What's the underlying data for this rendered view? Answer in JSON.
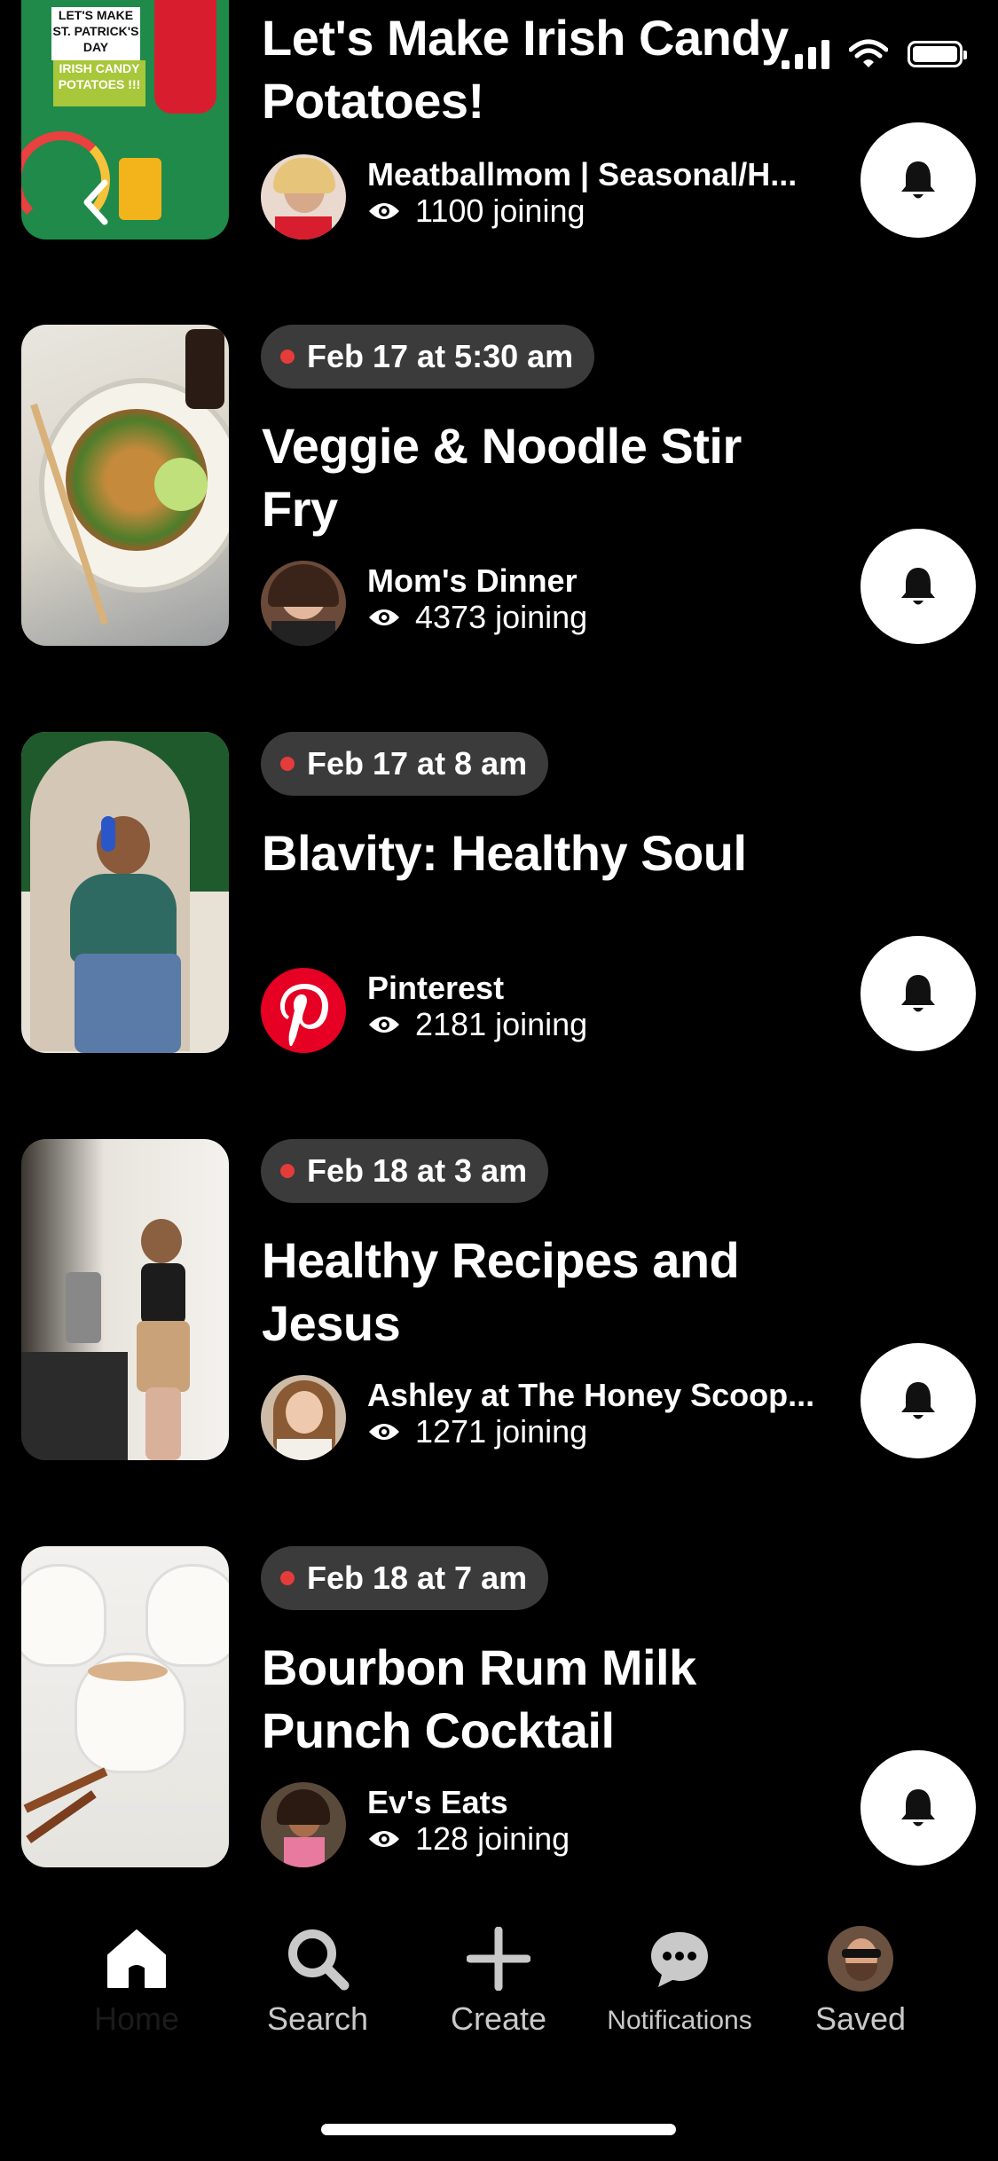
{
  "status_bar": {
    "signal_icon": "cellular-signal-icon",
    "wifi_icon": "wifi-icon",
    "battery_icon": "battery-icon"
  },
  "events": [
    {
      "date": "",
      "title": "Let's Make Irish Candy Potatoes!",
      "creator": "Meatballmom |  Seasonal/H...",
      "joining": "1100 joining",
      "thumbnail_text": "LET'S MAKE ST. PATRICK'S DAY IRISH CANDY POTATOES !!!",
      "bell_icon": "bell-icon"
    },
    {
      "date": "Feb 17 at 5:30 am",
      "title": "Veggie & Noodle Stir Fry",
      "creator": "Mom's Dinner",
      "joining": "4373 joining",
      "bell_icon": "bell-icon"
    },
    {
      "date": "Feb 17 at 8 am",
      "title": "Blavity: Healthy Soul",
      "creator": "Pinterest",
      "joining": "2181 joining",
      "bell_icon": "bell-icon"
    },
    {
      "date": "Feb 18 at 3 am",
      "title": "Healthy Recipes and Jesus",
      "creator": "Ashley at The Honey Scoop...",
      "joining": "1271 joining",
      "bell_icon": "bell-icon"
    },
    {
      "date": "Feb 18 at 7 am",
      "title": "Bourbon Rum Milk Punch Cocktail",
      "creator": "Ev's Eats",
      "joining": "128 joining",
      "bell_icon": "bell-icon"
    }
  ],
  "tabbar": {
    "home": "Home",
    "search": "Search",
    "create": "Create",
    "notifications": "Notifications",
    "saved": "Saved"
  },
  "colors": {
    "background": "#000000",
    "live_dot": "#e63b3b",
    "pill": "#3b3b3b",
    "pinterest_red": "#e60023"
  }
}
